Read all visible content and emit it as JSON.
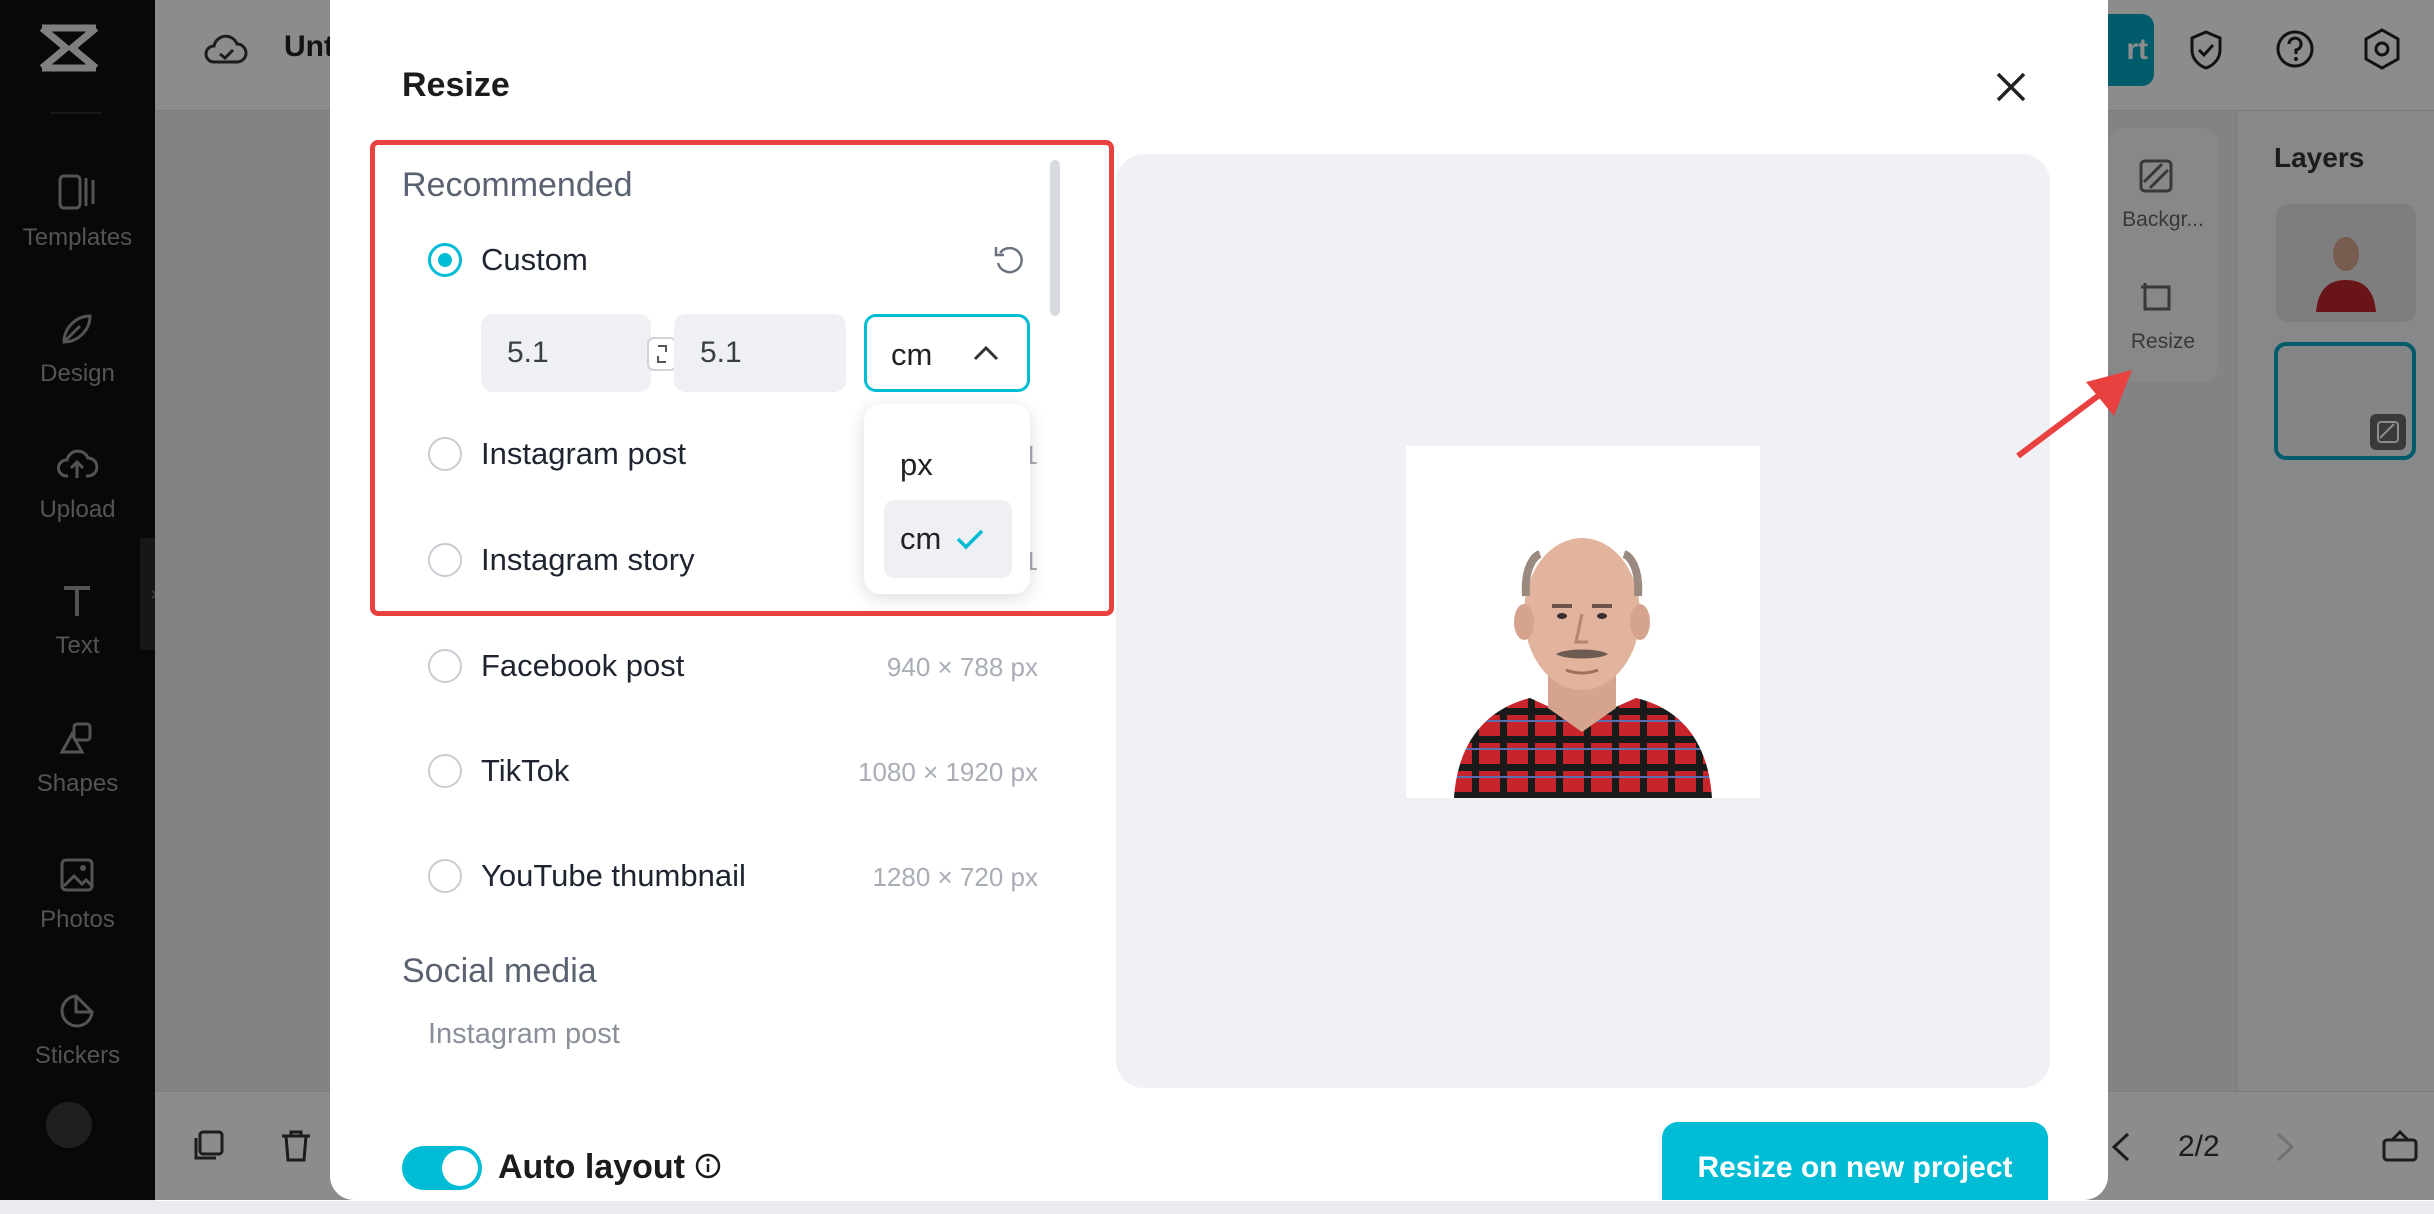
{
  "sidebar": {
    "items": [
      {
        "label": "Templates",
        "icon": "templates-icon"
      },
      {
        "label": "Design",
        "icon": "design-icon"
      },
      {
        "label": "Upload",
        "icon": "upload-icon"
      },
      {
        "label": "Text",
        "icon": "text-icon"
      },
      {
        "label": "Shapes",
        "icon": "shapes-icon"
      },
      {
        "label": "Photos",
        "icon": "photos-icon"
      },
      {
        "label": "Stickers",
        "icon": "stickers-icon"
      }
    ]
  },
  "topbar": {
    "title_fragment": "Unt",
    "export_fragment": "rt"
  },
  "tools": {
    "background_label": "Backgr...",
    "resize_label": "Resize"
  },
  "layers": {
    "title": "Layers"
  },
  "pagination": {
    "indicator": "2/2"
  },
  "modal": {
    "title": "Resize",
    "recommended_title": "Recommended",
    "custom": {
      "label": "Custom",
      "width": "5.1",
      "height": "5.1",
      "unit": "cm"
    },
    "unit_options": [
      {
        "label": "px",
        "selected": false
      },
      {
        "label": "cm",
        "selected": true
      }
    ],
    "presets": [
      {
        "label": "Instagram post",
        "size": "1",
        "selected": false
      },
      {
        "label": "Instagram story",
        "size": "1",
        "selected": false
      },
      {
        "label": "Facebook post",
        "size": "940 × 788 px",
        "selected": false
      },
      {
        "label": "TikTok",
        "size": "1080 × 1920 px",
        "selected": false
      },
      {
        "label": "YouTube thumbnail",
        "size": "1280 × 720 px",
        "selected": false
      }
    ],
    "social_media_title": "Social media",
    "social_media_first": "Instagram post",
    "auto_layout_label": "Auto layout",
    "auto_layout_on": true,
    "resize_button": "Resize on new project"
  },
  "colors": {
    "accent": "#00bcd4",
    "highlight_annotation": "#e8413f"
  }
}
